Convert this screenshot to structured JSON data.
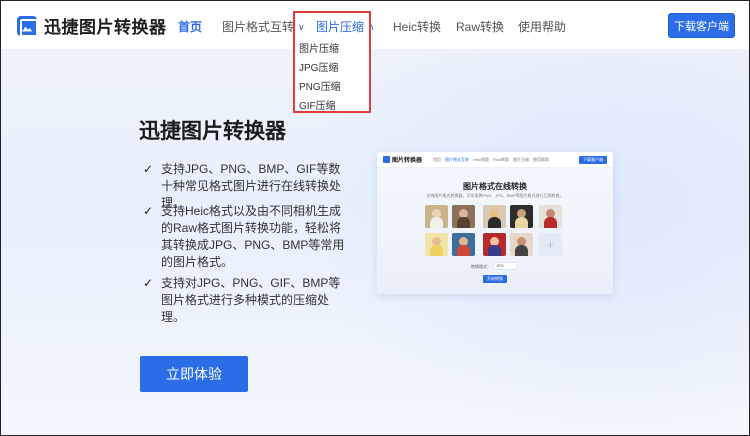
{
  "header": {
    "logo_text": "迅捷图片转换器",
    "nav": [
      {
        "label": "首页",
        "state": "active"
      },
      {
        "label": "图片格式互转",
        "has_chevron": true
      },
      {
        "label": "图片压缩",
        "has_chevron": true,
        "state": "open"
      },
      {
        "label": "Heic转换"
      },
      {
        "label": "Raw转换"
      },
      {
        "label": "使用帮助"
      }
    ],
    "download_label": "下载客户端",
    "chevron_down": "∨",
    "chevron_up": "∧"
  },
  "dropdown": {
    "items": [
      "图片压缩",
      "JPG压缩",
      "PNG压缩",
      "GIF压缩"
    ]
  },
  "hero": {
    "title": "迅捷图片转换器",
    "check_glyph": "✓",
    "features": [
      "支持JPG、PNG、BMP、GIF等数十种常见格式图片进行在线转换处理。",
      "支持Heic格式以及由不同相机生成的Raw格式图片转换功能，轻松将其转换成JPG、PNG、BMP等常用的图片格式。",
      "支持对JPG、PNG、GIF、BMP等图片格式进行多种模式的压缩处理。"
    ],
    "cta_label": "立即体验"
  },
  "preview": {
    "logo_text": "图片转换器",
    "nav": [
      "首页",
      "图片格式互转",
      "Heic转换",
      "Raw转换",
      "图片压缩",
      "使用帮助"
    ],
    "download_label": "下载客户端",
    "title": "图片格式在线转换",
    "subtitle": "在线图片格式转换器，可实现将PNG、JPG、BMP等图片格式进行互相转换。",
    "format_label": "转换格式：",
    "format_value": "JPG",
    "convert_label": "开始转换",
    "add_glyph": "+"
  },
  "colors": {
    "accent": "#2b6de6",
    "highlight_border": "#e23b3b"
  }
}
